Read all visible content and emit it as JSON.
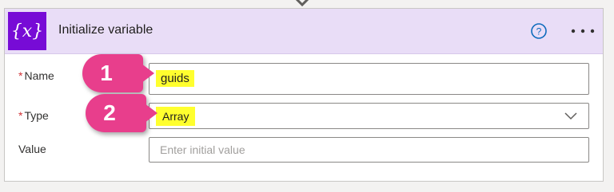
{
  "card": {
    "title": "Initialize variable",
    "icon_glyph": "{x}",
    "accent_color": "#770bd6",
    "header_color": "#e9ddf7"
  },
  "fields": {
    "name": {
      "label": "Name",
      "required_mark": "*",
      "value": "guids"
    },
    "type": {
      "label": "Type",
      "required_mark": "*",
      "value": "Array"
    },
    "value": {
      "label": "Value",
      "placeholder": "Enter initial value"
    }
  },
  "annotations": {
    "badge1": "1",
    "badge2": "2",
    "badge_color": "#e83e8c",
    "highlight_color": "#ffff2e"
  },
  "icons": [
    "variable-icon",
    "help-icon",
    "more-options-icon",
    "chevron-down-icon",
    "connector-arrow-icon"
  ]
}
